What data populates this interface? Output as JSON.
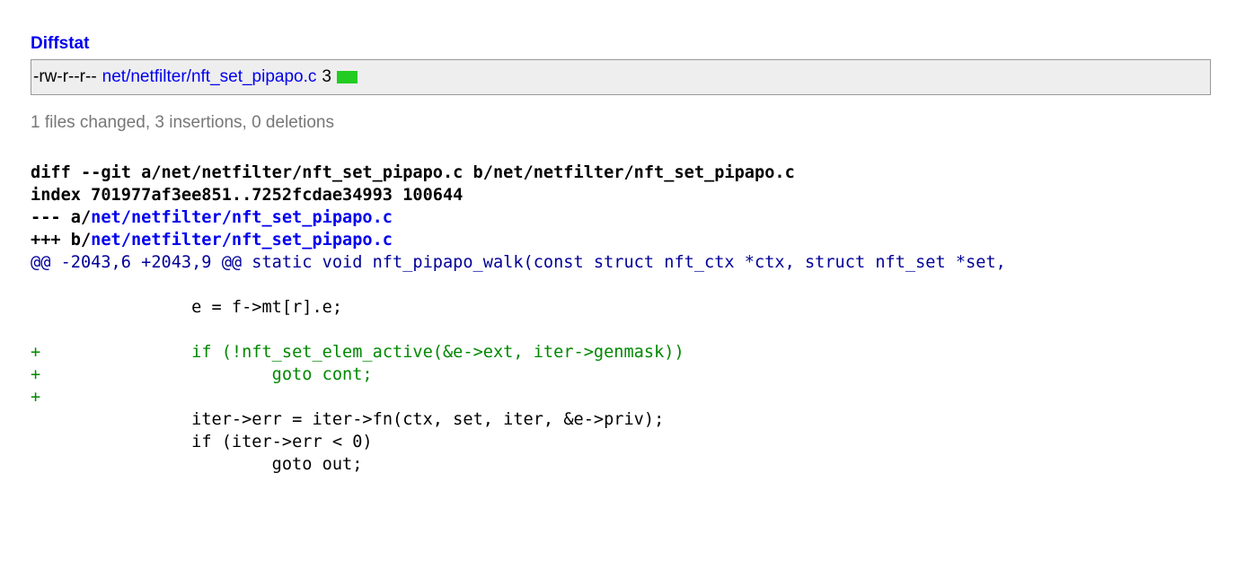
{
  "diffstat": {
    "title": "Diffstat",
    "mode": "-rw-r--r--",
    "file": "net/netfilter/nft_set_pipapo.c",
    "count": "3",
    "graph_color": "#22cc22"
  },
  "summary": "1 files changed, 3 insertions, 0 deletions",
  "diff": {
    "git_prefix": "diff --git a/net/netfilter/nft_set_pipapo.c b/net/netfilter/nft_set_pipapo.c",
    "index": "index 701977af3ee851..7252fcdae34993 100644",
    "minus_prefix": "--- a/",
    "minus_file": "net/netfilter/nft_set_pipapo.c",
    "plus_prefix": "+++ b/",
    "plus_file": "net/netfilter/nft_set_pipapo.c",
    "hunk": "@@ -2043,6 +2043,9 @@ static void nft_pipapo_walk(const struct nft_ctx *ctx, struct nft_set *set,",
    "lines": [
      {
        "type": "ctx",
        "text": " "
      },
      {
        "type": "ctx",
        "text": " \t\te = f->mt[r].e;"
      },
      {
        "type": "ctx",
        "text": " "
      },
      {
        "type": "add",
        "text": "+\t\tif (!nft_set_elem_active(&e->ext, iter->genmask))"
      },
      {
        "type": "add",
        "text": "+\t\t\tgoto cont;"
      },
      {
        "type": "add",
        "text": "+"
      },
      {
        "type": "ctx",
        "text": " \t\titer->err = iter->fn(ctx, set, iter, &e->priv);"
      },
      {
        "type": "ctx",
        "text": " \t\tif (iter->err < 0)"
      },
      {
        "type": "ctx",
        "text": " \t\t\tgoto out;"
      }
    ]
  }
}
